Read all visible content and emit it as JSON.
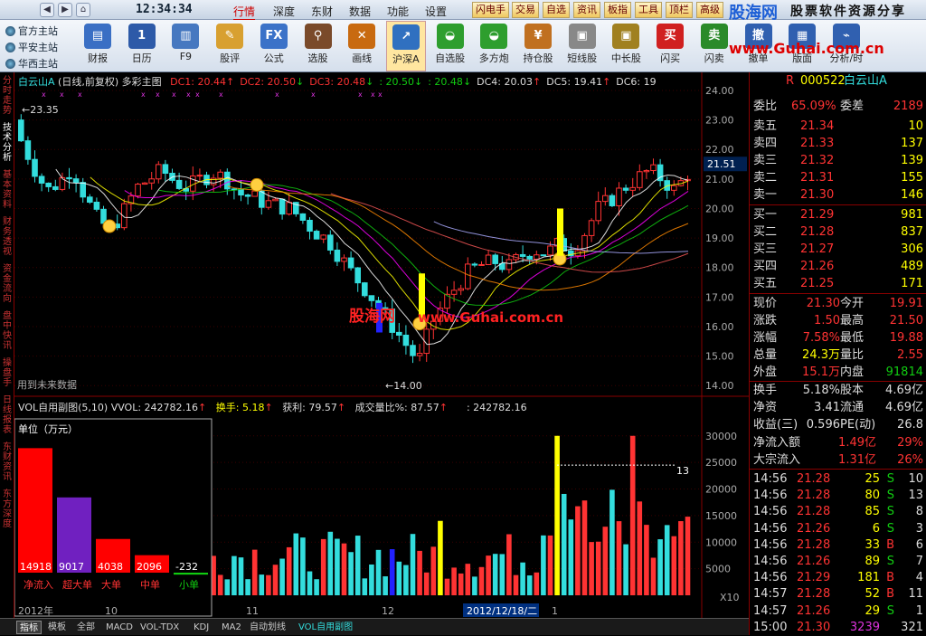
{
  "nav": {
    "back": "◀",
    "fwd": "▶",
    "home": "⌂",
    "clock": "12:34:34"
  },
  "menus": [
    "行情",
    "深度",
    "东财",
    "数据",
    "功能",
    "设置"
  ],
  "quick": [
    "闪电手",
    "交易",
    "自选",
    "资讯",
    "板指",
    "工具",
    "顶栏",
    "高级"
  ],
  "logo": {
    "brand": "股海网",
    "tagline": "股票软件资源分享",
    "url": "www.Guhai.com.cn"
  },
  "stations": [
    "官方主站",
    "平安主站",
    "华西主站"
  ],
  "tools": [
    {
      "label": "财报",
      "icon": "report-icon",
      "glyph": "▤",
      "color": "#3a6fc4"
    },
    {
      "label": "日历",
      "icon": "calendar-icon",
      "glyph": "1",
      "color": "#2d5aa8"
    },
    {
      "label": "F9",
      "icon": "f9-chart-icon",
      "glyph": "▥",
      "color": "#4678c0"
    },
    {
      "label": "股评",
      "icon": "comment-icon",
      "glyph": "✎",
      "color": "#d8a030"
    },
    {
      "label": "公式",
      "icon": "formula-icon",
      "glyph": "FX",
      "color": "#3b72c8"
    },
    {
      "label": "选股",
      "icon": "select-stock-icon",
      "glyph": "⚲",
      "color": "#7a4a2a"
    },
    {
      "label": "画线",
      "icon": "draw-line-icon",
      "glyph": "✕",
      "color": "#c86a10"
    },
    {
      "label": "沪深A",
      "icon": "market-a-icon",
      "glyph": "↗",
      "color": "#3070c0"
    },
    {
      "label": "自选股",
      "icon": "basket-icon",
      "glyph": "◒",
      "color": "#2e9e2e"
    },
    {
      "label": "多方炮",
      "icon": "basket2-icon",
      "glyph": "◒",
      "color": "#2e9e2e"
    },
    {
      "label": "持仓股",
      "icon": "yen-icon",
      "glyph": "¥",
      "color": "#c07020"
    },
    {
      "label": "短线股",
      "icon": "short-term-icon",
      "glyph": "▣",
      "color": "#888"
    },
    {
      "label": "中长股",
      "icon": "long-term-icon",
      "glyph": "▣",
      "color": "#a08020"
    },
    {
      "label": "闪买",
      "icon": "flash-buy-icon",
      "glyph": "买",
      "color": "#d02020"
    },
    {
      "label": "闪卖",
      "icon": "flash-sell-icon",
      "glyph": "卖",
      "color": "#2a8a2a"
    },
    {
      "label": "撤单",
      "icon": "cancel-order-icon",
      "glyph": "撤",
      "color": "#3060b0"
    },
    {
      "label": "版面",
      "icon": "layout-icon",
      "glyph": "▦",
      "color": "#3060b0"
    },
    {
      "label": "分析/时",
      "icon": "analysis-icon",
      "glyph": "⌁",
      "color": "#3060b0"
    }
  ],
  "side_tabs": [
    "分时走势",
    "技术分析",
    "基本资料",
    "财务透视",
    "资金流向",
    "盘中快讯",
    "操盘手",
    "日线报表",
    "东财资讯",
    "东方深度"
  ],
  "main_header": {
    "name": "白云山A",
    "mode": "(日线,前复权)",
    "indicator": "多彩主图",
    "dc": [
      {
        "label": "DC1: 20.44",
        "arrow": "↑",
        "color": "#f33"
      },
      {
        "label": "DC2: 20.50",
        "arrow": "↓",
        "color": "#f33"
      },
      {
        "label": "DC3: 20.48",
        "arrow": "↓",
        "color": "#f33"
      },
      {
        "label": ": 20.50",
        "arrow": "↓",
        "color": "#1c1"
      },
      {
        "label": ": 20.48",
        "arrow": "↓",
        "color": "#1c1"
      },
      {
        "label": "DC4: 20.03",
        "arrow": "↑",
        "color": "#ddd"
      },
      {
        "label": "DC5: 19.41",
        "arrow": "↑",
        "color": "#ddd"
      },
      {
        "label": "DC6: 19",
        "arrow": "",
        "color": "#ddd"
      }
    ]
  },
  "price_axis": [
    "24.00",
    "23.00",
    "22.00",
    "21.00",
    "20.00",
    "19.00",
    "18.00",
    "17.00",
    "16.00",
    "15.00",
    "14.00"
  ],
  "price_marks": {
    "high": "23.35",
    "low": "14.00",
    "current": "21.51"
  },
  "future_note": "用到未来数据",
  "watermark": {
    "brand": "股海网",
    "url": "www.Guhai.com.cn"
  },
  "sub_header": {
    "title": "VOL自用副图(5,10)",
    "vvol": "VVOL: 242782.16",
    "turnover": "换手: 5.18",
    "profit": "获利: 79.57",
    "vol_ratio": "成交量比%: 87.57",
    "val": ": 242782.16"
  },
  "vol_axis": [
    "30000",
    "25000",
    "20000",
    "15000",
    "10000",
    "5000"
  ],
  "vol_mark": "13",
  "unit_box": {
    "title": "单位（万元）",
    "bars": [
      {
        "label": "净流入",
        "value": "14918",
        "num": 14918,
        "color": "#f00"
      },
      {
        "label": "超大单",
        "value": "9017",
        "num": 9017,
        "color": "#7020c0"
      },
      {
        "label": "大单",
        "value": "4038",
        "num": 4038,
        "color": "#f00"
      },
      {
        "label": "中单",
        "value": "2096",
        "num": 2096,
        "color": "#f00"
      },
      {
        "label": "小单",
        "value": "-232",
        "num": -232,
        "color": "#1c1"
      }
    ]
  },
  "x_labels": {
    "y2012": "2012年",
    "m10": "10",
    "m11": "11",
    "m12": "12",
    "date": "2012/12/18/二",
    "m1": "1",
    "x10": "X10"
  },
  "bottom_tabs": [
    "指标",
    "模板",
    "全部",
    "MACD",
    "VOL-TDX",
    "KDJ",
    "MA2",
    "自动划线",
    "VOL自用副图"
  ],
  "quote": {
    "code": "000522",
    "name": "白云山A",
    "flag": "R",
    "weibi": {
      "label": "委比",
      "value": "65.09%",
      "label2": "委差",
      "value2": "2189"
    },
    "asks": [
      {
        "label": "卖五",
        "price": "21.34",
        "vol": "10"
      },
      {
        "label": "卖四",
        "price": "21.33",
        "vol": "137"
      },
      {
        "label": "卖三",
        "price": "21.32",
        "vol": "139"
      },
      {
        "label": "卖二",
        "price": "21.31",
        "vol": "155"
      },
      {
        "label": "卖一",
        "price": "21.30",
        "vol": "146"
      }
    ],
    "bids": [
      {
        "label": "买一",
        "price": "21.29",
        "vol": "981"
      },
      {
        "label": "买二",
        "price": "21.28",
        "vol": "837"
      },
      {
        "label": "买三",
        "price": "21.27",
        "vol": "306"
      },
      {
        "label": "买四",
        "price": "21.26",
        "vol": "489"
      },
      {
        "label": "买五",
        "price": "21.25",
        "vol": "171"
      }
    ],
    "stats": [
      {
        "l1": "现价",
        "v1": "21.30",
        "c1": "r",
        "l2": "今开",
        "v2": "19.91",
        "c2": "r"
      },
      {
        "l1": "涨跌",
        "v1": "1.50",
        "c1": "r",
        "l2": "最高",
        "v2": "21.50",
        "c2": "r"
      },
      {
        "l1": "涨幅",
        "v1": "7.58%",
        "c1": "r",
        "l2": "最低",
        "v2": "19.88",
        "c2": "r"
      },
      {
        "l1": "总量",
        "v1": "24.3万",
        "c1": "y",
        "l2": "量比",
        "v2": "2.55",
        "c2": "r"
      },
      {
        "l1": "外盘",
        "v1": "15.1万",
        "c1": "r",
        "l2": "内盘",
        "v2": "91814",
        "c2": "g"
      }
    ],
    "stats2": [
      {
        "l1": "换手",
        "v1": "5.18%",
        "c1": "w",
        "l2": "股本",
        "v2": "4.69亿",
        "c2": "w"
      },
      {
        "l1": "净资",
        "v1": "3.41",
        "c1": "w",
        "l2": "流通",
        "v2": "4.69亿",
        "c2": "w"
      },
      {
        "l1": "收益(三)",
        "v1": "0.596",
        "c1": "w",
        "l2": "PE(动)",
        "v2": "26.8",
        "c2": "w"
      }
    ],
    "flows": [
      {
        "label": "净流入额",
        "value": "1.49亿",
        "pct": "29%"
      },
      {
        "label": "大宗流入",
        "value": "1.31亿",
        "pct": "26%"
      }
    ],
    "ticks": [
      {
        "t": "14:56",
        "p": "21.28",
        "v": "25",
        "d": "S"
      },
      {
        "t": "14:56",
        "p": "21.28",
        "v": "80",
        "d": "S"
      },
      {
        "t": "14:56",
        "p": "21.28",
        "v": "85",
        "d": "S"
      },
      {
        "t": "14:56",
        "p": "21.26",
        "v": "6",
        "d": "S"
      },
      {
        "t": "14:56",
        "p": "21.28",
        "v": "33",
        "d": "B"
      },
      {
        "t": "14:56",
        "p": "21.26",
        "v": "89",
        "d": "S"
      },
      {
        "t": "14:56",
        "p": "21.29",
        "v": "181",
        "d": "B"
      },
      {
        "t": "14:57",
        "p": "21.28",
        "v": "52",
        "d": "B"
      },
      {
        "t": "14:57",
        "p": "21.26",
        "v": "29",
        "d": "S"
      },
      {
        "t": "15:00",
        "p": "21.30",
        "v": "3239",
        "d": "",
        "x": "321"
      }
    ],
    "tick_extra": [
      "10",
      "13",
      "8",
      "3",
      "6",
      "7",
      "4",
      "11",
      "1"
    ]
  }
}
